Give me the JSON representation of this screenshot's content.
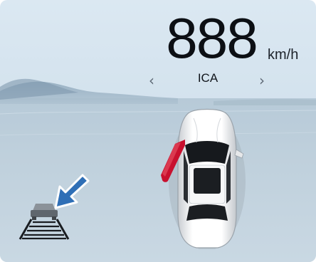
{
  "cluster": {
    "speed_value": "888",
    "speed_unit": "km/h",
    "mode_label": "ICA",
    "prev_chevron": "‹",
    "next_chevron": "›"
  },
  "icons": {
    "lane_keeping": "lane-assist-icon",
    "callout": "callout-arrow-icon",
    "ego_vehicle": "car-top-view-icon",
    "door_open": "door-open-indicator-icon"
  },
  "colors": {
    "sky": "#cfe0ec",
    "water": "#b9cdda",
    "callout_blue": "#2f6fb6",
    "door_red": "#c8102e"
  }
}
